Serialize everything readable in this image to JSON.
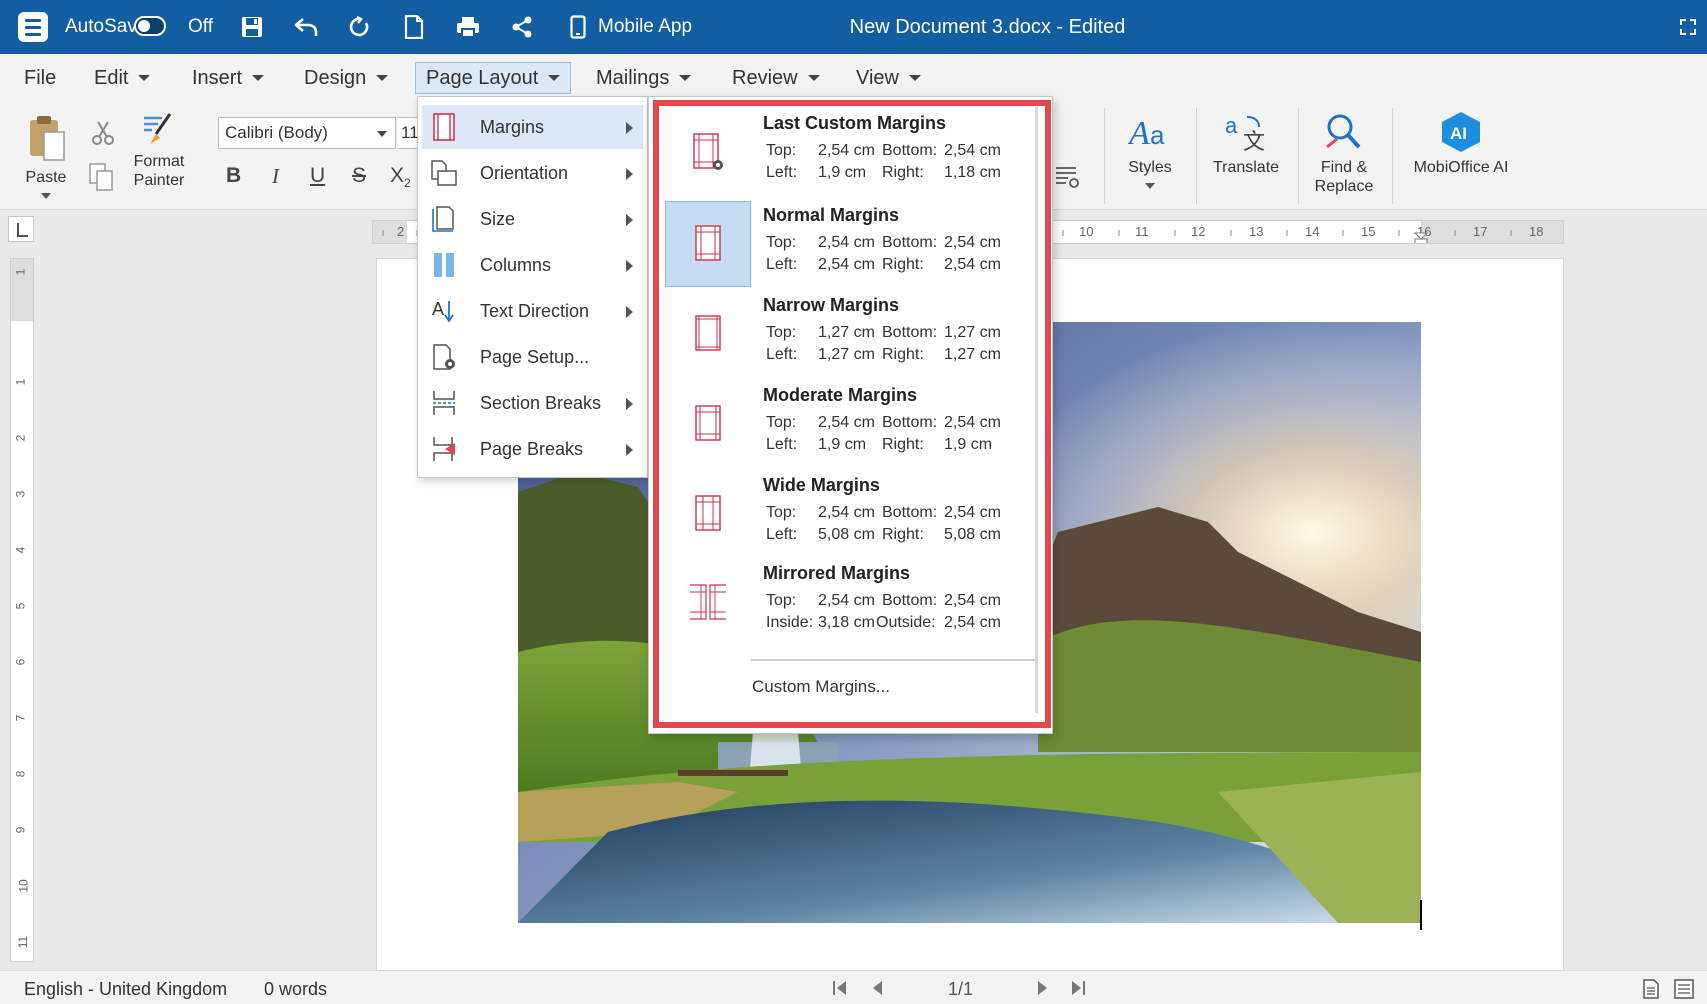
{
  "titlebar": {
    "autosave_label": "AutoSave",
    "autosave_state": "Off",
    "mobile_app_label": "Mobile App",
    "document_title": "New Document 3.docx - Edited"
  },
  "menubar": {
    "items": [
      {
        "label": "File",
        "has_caret": false
      },
      {
        "label": "Edit",
        "has_caret": true
      },
      {
        "label": "Insert",
        "has_caret": true
      },
      {
        "label": "Design",
        "has_caret": true
      },
      {
        "label": "Page Layout",
        "has_caret": true,
        "active": true
      },
      {
        "label": "Mailings",
        "has_caret": true
      },
      {
        "label": "Review",
        "has_caret": true
      },
      {
        "label": "View",
        "has_caret": true
      }
    ]
  },
  "ribbon": {
    "paste_label": "Paste",
    "format_painter_label": "Format\nPainter",
    "font_name": "Calibri (Body)",
    "font_size": "11",
    "styles_label": "Styles",
    "translate_label": "Translate",
    "find_replace_label": "Find &\nReplace",
    "mobioffice_label": "MobiOffice AI",
    "ai_badge": "AI"
  },
  "ruler": {
    "h_numbers": [
      "2",
      "10",
      "11",
      "12",
      "13",
      "14",
      "15",
      "16",
      "17",
      "18"
    ],
    "v_numbers": [
      "1",
      "1",
      "2",
      "3",
      "4",
      "5",
      "6",
      "7",
      "8",
      "9",
      "10",
      "11"
    ]
  },
  "page_layout_menu": {
    "items": [
      {
        "label": "Margins",
        "icon": "margins-icon",
        "submenu": true,
        "selected": true
      },
      {
        "label": "Orientation",
        "icon": "orientation-icon",
        "submenu": true
      },
      {
        "label": "Size",
        "icon": "size-icon",
        "submenu": true
      },
      {
        "label": "Columns",
        "icon": "columns-icon",
        "submenu": true
      },
      {
        "label": "Text Direction",
        "icon": "text-direction-icon",
        "submenu": true
      },
      {
        "label": "Page Setup...",
        "icon": "page-setup-icon",
        "submenu": false
      },
      {
        "label": "Section Breaks",
        "icon": "section-breaks-icon",
        "submenu": true
      },
      {
        "label": "Page Breaks",
        "icon": "page-breaks-icon",
        "submenu": true
      }
    ]
  },
  "margins_panel": {
    "options": [
      {
        "name": "Last Custom Margins",
        "row1": [
          "Top:",
          "2,54 cm",
          "Bottom:",
          "2,54 cm"
        ],
        "row2": [
          "Left:",
          "1,9 cm",
          "Right:",
          "1,18 cm"
        ],
        "selected": false
      },
      {
        "name": "Normal Margins",
        "row1": [
          "Top:",
          "2,54 cm",
          "Bottom:",
          "2,54 cm"
        ],
        "row2": [
          "Left:",
          "2,54 cm",
          "Right:",
          "2,54 cm"
        ],
        "selected": true
      },
      {
        "name": "Narrow Margins",
        "row1": [
          "Top:",
          "1,27 cm",
          "Bottom:",
          "1,27 cm"
        ],
        "row2": [
          "Left:",
          "1,27 cm",
          "Right:",
          "1,27 cm"
        ],
        "selected": false
      },
      {
        "name": "Moderate Margins",
        "row1": [
          "Top:",
          "2,54 cm",
          "Bottom:",
          "2,54 cm"
        ],
        "row2": [
          "Left:",
          "1,9 cm",
          "Right:",
          "1,9 cm"
        ],
        "selected": false
      },
      {
        "name": "Wide Margins",
        "row1": [
          "Top:",
          "2,54 cm",
          "Bottom:",
          "2,54 cm"
        ],
        "row2": [
          "Left:",
          "5,08 cm",
          "Right:",
          "5,08 cm"
        ],
        "selected": false
      },
      {
        "name": "Mirrored Margins",
        "row1": [
          "Top:",
          "2,54 cm",
          "Bottom:",
          "2,54 cm"
        ],
        "row2": [
          "Inside:",
          "3,18 cm",
          "Outside:",
          "2,54 cm"
        ],
        "selected": false
      }
    ],
    "custom_label": "Custom Margins..."
  },
  "statusbar": {
    "language": "English - United Kingdom",
    "word_count": "0 words",
    "page_indicator": "1/1"
  },
  "colors": {
    "titlebar": "#135ea3",
    "highlight_frame": "#e4474d",
    "selection": "#dce8f6",
    "margin_guides": "#d0314a"
  }
}
